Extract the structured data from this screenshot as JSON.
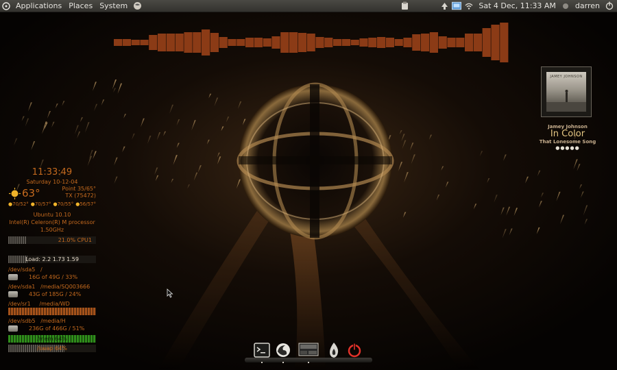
{
  "panel": {
    "menus": [
      "Applications",
      "Places",
      "System"
    ],
    "clock": "Sat  4 Dec, 11:33 AM",
    "user": "darren"
  },
  "music": {
    "cover_text": "JAMEY JOHNSON",
    "artist": "Jamey Johnson",
    "album": "In Color",
    "song": "That Lonesome Song",
    "rating": "●●●●●"
  },
  "conky": {
    "time": "11:33:49",
    "date": "Saturday 10-12-04",
    "temp": "63°",
    "dewpoint": "Point 35/65°",
    "location": "TX (75472)",
    "forecast": [
      "70/52°",
      "70/57°",
      "70/55°",
      "56/57°"
    ],
    "os": "Ubuntu 10.10",
    "cpu_name": "Intel(R) Celeron(R) M processor",
    "cpu_speed": "1.50GHz",
    "cpu_text": "21.0% CPU1",
    "cpu_fraction": 0.21,
    "load": "Load: 2.2 1.73 1.59",
    "disks": [
      {
        "dev": "/dev/sda5",
        "mount": "/",
        "usage": "16G of 49G / 33%"
      },
      {
        "dev": "/dev/sda1",
        "mount": "/media/SQ003666",
        "usage": "43G of 185G / 24%"
      },
      {
        "dev": "/dev/sr1",
        "mount": "/media/WD",
        "usage": ""
      },
      {
        "dev": "/dev/sdb5",
        "mount": "/media/H",
        "usage": "236G of 466G / 51%"
      }
    ],
    "mem_text": "/mem 64%",
    "bottom_text": "/swap 64%"
  },
  "colors": {
    "accent": "#c56a1e",
    "bar_green": "#2f8d1b",
    "bar_orange": "#a4521a",
    "visualizer": "#8b3b16"
  },
  "icons": {
    "dock": [
      "terminal-icon",
      "firefox-icon",
      "desktop-icon",
      "fire-icon",
      "power-icon"
    ],
    "tray": [
      "clipboard-icon",
      "upload-icon",
      "network-icon",
      "volume-icon",
      "mail-icon",
      "power-icon"
    ]
  }
}
